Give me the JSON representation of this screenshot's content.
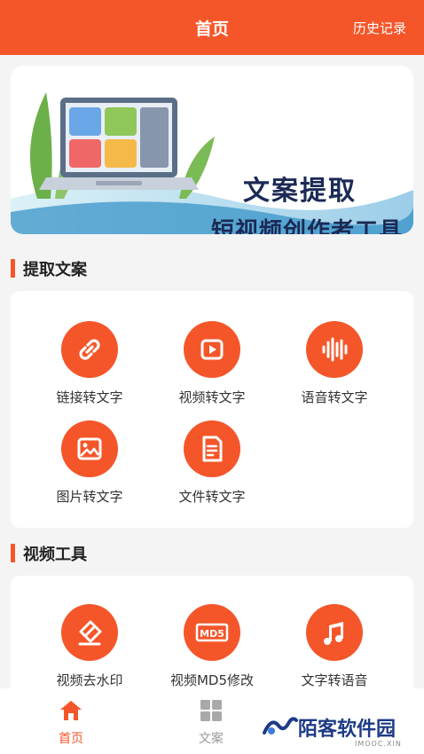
{
  "header": {
    "title": "首页",
    "history_label": "历史记录"
  },
  "banner": {
    "line1": "文案提取",
    "line2": "短视频创作者工具"
  },
  "sections": {
    "extract": {
      "title": "提取文案",
      "tools": [
        {
          "label": "链接转文字",
          "icon": "link-icon"
        },
        {
          "label": "视频转文字",
          "icon": "play-icon"
        },
        {
          "label": "语音转文字",
          "icon": "audio-wave-icon"
        },
        {
          "label": "图片转文字",
          "icon": "image-icon"
        },
        {
          "label": "文件转文字",
          "icon": "document-icon"
        }
      ]
    },
    "video": {
      "title": "视频工具",
      "tools": [
        {
          "label": "视频去水印",
          "icon": "eraser-icon"
        },
        {
          "label": "视频MD5修改",
          "icon": "md5-icon",
          "badge": "MD5"
        },
        {
          "label": "文字转语音",
          "icon": "music-note-icon"
        }
      ]
    }
  },
  "bottom_nav": {
    "items": [
      {
        "label": "首页",
        "icon": "home-icon",
        "active": true
      },
      {
        "label": "文案",
        "icon": "grid-icon",
        "active": false
      }
    ]
  },
  "watermark": {
    "text": "陌客软件园",
    "sub": "IMOOC.XIN"
  },
  "colors": {
    "accent": "#f4562a",
    "text": "#333333",
    "inactive": "#999999"
  }
}
